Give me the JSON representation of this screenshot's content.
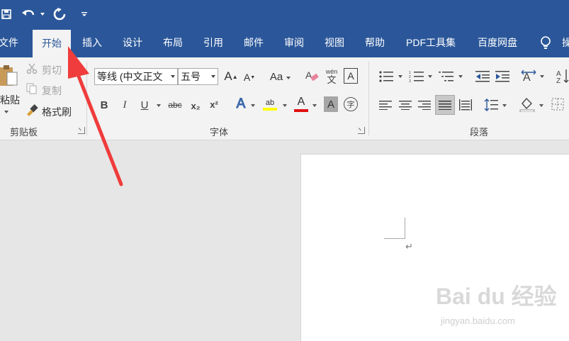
{
  "tabs": [
    {
      "label": "文件",
      "active": false
    },
    {
      "label": "开始",
      "active": true
    },
    {
      "label": "插入",
      "active": false
    },
    {
      "label": "设计",
      "active": false
    },
    {
      "label": "布局",
      "active": false
    },
    {
      "label": "引用",
      "active": false
    },
    {
      "label": "邮件",
      "active": false
    },
    {
      "label": "审阅",
      "active": false
    },
    {
      "label": "视图",
      "active": false
    },
    {
      "label": "帮助",
      "active": false
    },
    {
      "label": "PDF工具集",
      "active": false
    },
    {
      "label": "百度网盘",
      "active": false
    }
  ],
  "tell_me_partial": "操",
  "clipboard": {
    "paste_label": "粘贴",
    "cut_label": "剪切",
    "copy_label": "复制",
    "format_painter_label": "格式刷",
    "group_label": "剪贴板"
  },
  "font": {
    "font_name": "等线 (中文正文",
    "font_size": "五号",
    "change_case_label": "Aa",
    "phonetic_label": "wén",
    "phonetic_char": "文",
    "char_border_label": "A",
    "bold": "B",
    "italic": "I",
    "underline": "U",
    "strikethrough": "abc",
    "subscript": "x₂",
    "superscript": "x²",
    "text_effects": "A",
    "highlight": "ab",
    "font_color": "A",
    "char_shading": "A",
    "enclose": "字",
    "grow": "A",
    "shrink": "A",
    "group_label": "字体"
  },
  "paragraph": {
    "group_label": "段落"
  },
  "colors": {
    "title_bar": "#2b579a",
    "ribbon_bg": "#f3f3f3",
    "highlight_yellow": "#ffff00",
    "font_red": "#e01010",
    "arrow_red": "#f03c3c"
  },
  "watermark": {
    "brand": "Bai du 经验",
    "url": "jingyan.baidu.com"
  }
}
